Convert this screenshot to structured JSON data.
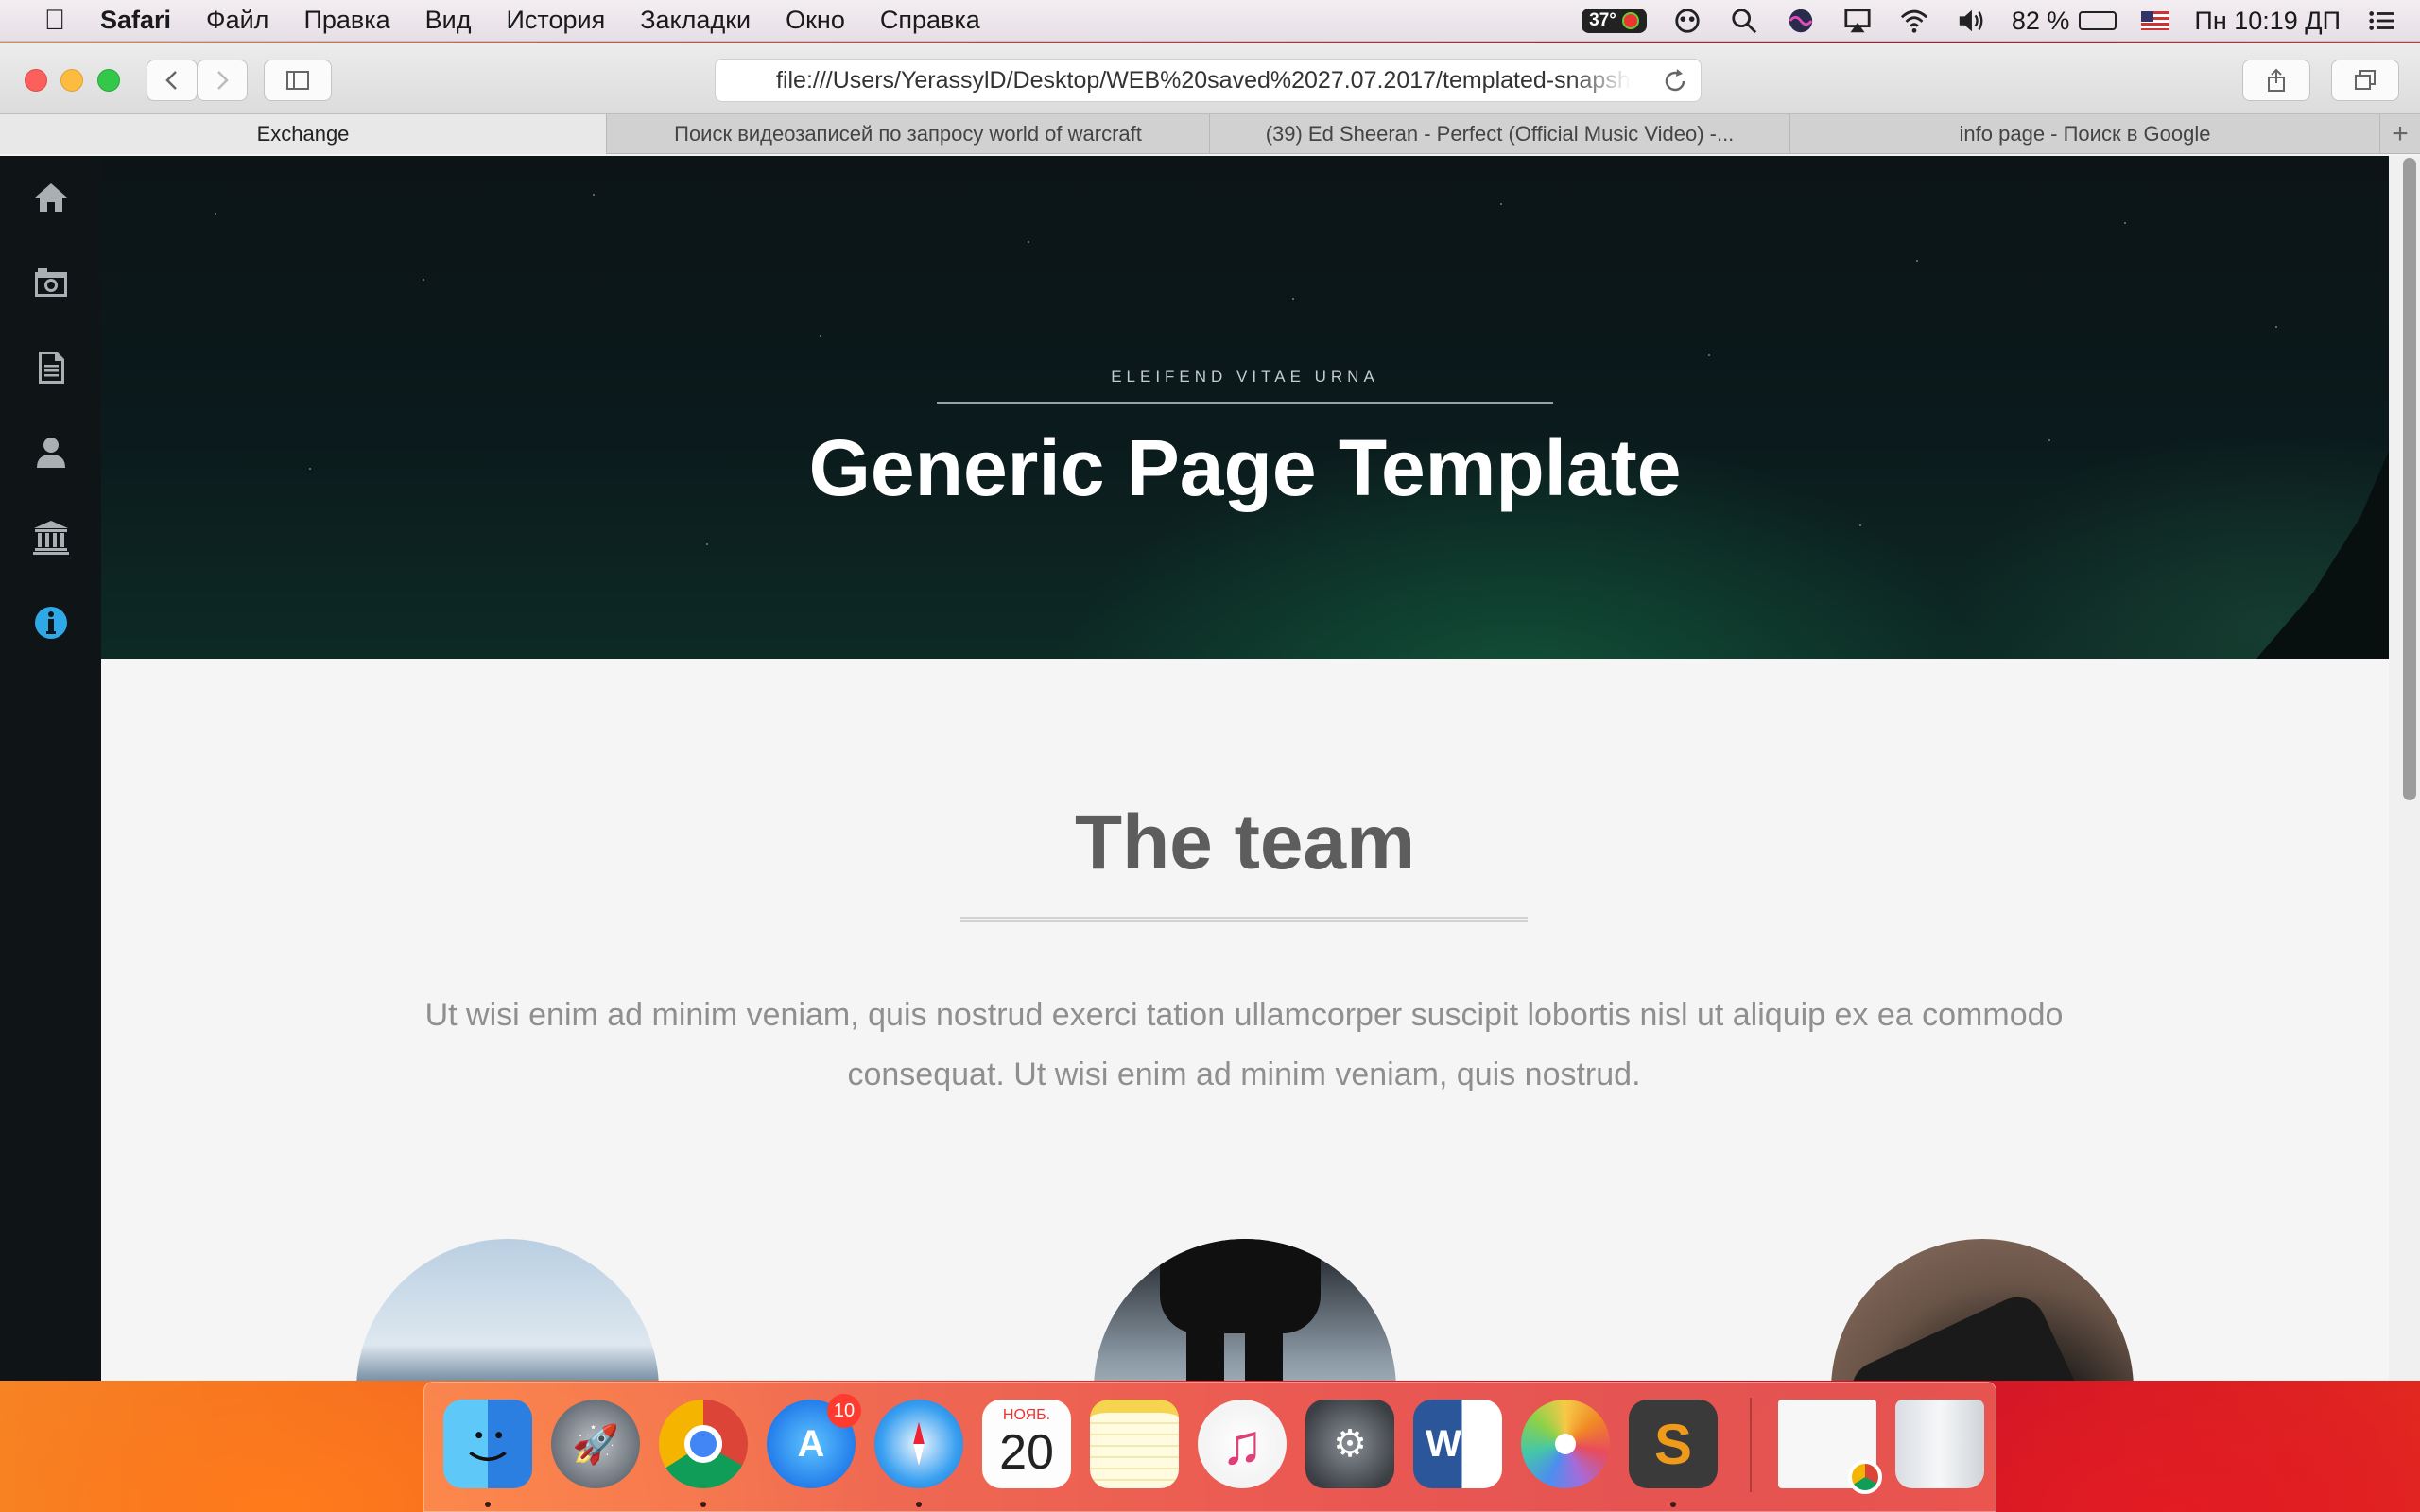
{
  "menubar": {
    "app_name": "Safari",
    "menus": [
      "Файл",
      "Правка",
      "Вид",
      "История",
      "Закладки",
      "Окно",
      "Справка"
    ],
    "temperature": "37°",
    "battery_percent": "82 %",
    "battery_level": 0.82,
    "clock": "Пн 10:19 ДП"
  },
  "browser": {
    "url": "file:///Users/YerassylD/Desktop/WEB%20saved%2027.07.2017/templated-snapsh",
    "tabs": [
      {
        "title": "Exchange",
        "active": true
      },
      {
        "title": "Поиск видеозаписей по запросу world of warcraft",
        "active": false
      },
      {
        "title": "(39) Ed Sheeran - Perfect (Official Music Video) -...",
        "active": false
      },
      {
        "title": "info page - Поиск в Google",
        "active": false
      }
    ]
  },
  "page": {
    "nav_icons": [
      "home-icon",
      "camera-icon",
      "document-icon",
      "user-icon",
      "bank-icon",
      "info-icon"
    ],
    "active_nav": "info-icon",
    "hero": {
      "eyebrow": "ELEIFEND VITAE URNA",
      "title": "Generic Page Template"
    },
    "team": {
      "title": "The team",
      "text": "Ut wisi enim ad minim veniam, quis nostrud exerci tation ullamcorper suscipit lobortis nisl ut aliquip ex ea commodo consequat. Ut wisi enim ad minim veniam, quis nostrud."
    },
    "accent_color": "#2fa8e8"
  },
  "dock": {
    "apps": [
      "Finder",
      "Launchpad",
      "Google Chrome",
      "App Store",
      "Safari",
      "Календарь",
      "Заметки",
      "iTunes",
      "Системные настройки",
      "Microsoft Word",
      "Фото",
      "Sublime Text",
      "Загрузки",
      "Корзина"
    ],
    "app_store_badge": "10",
    "calendar_month": "НОЯБ.",
    "calendar_day": "20"
  }
}
